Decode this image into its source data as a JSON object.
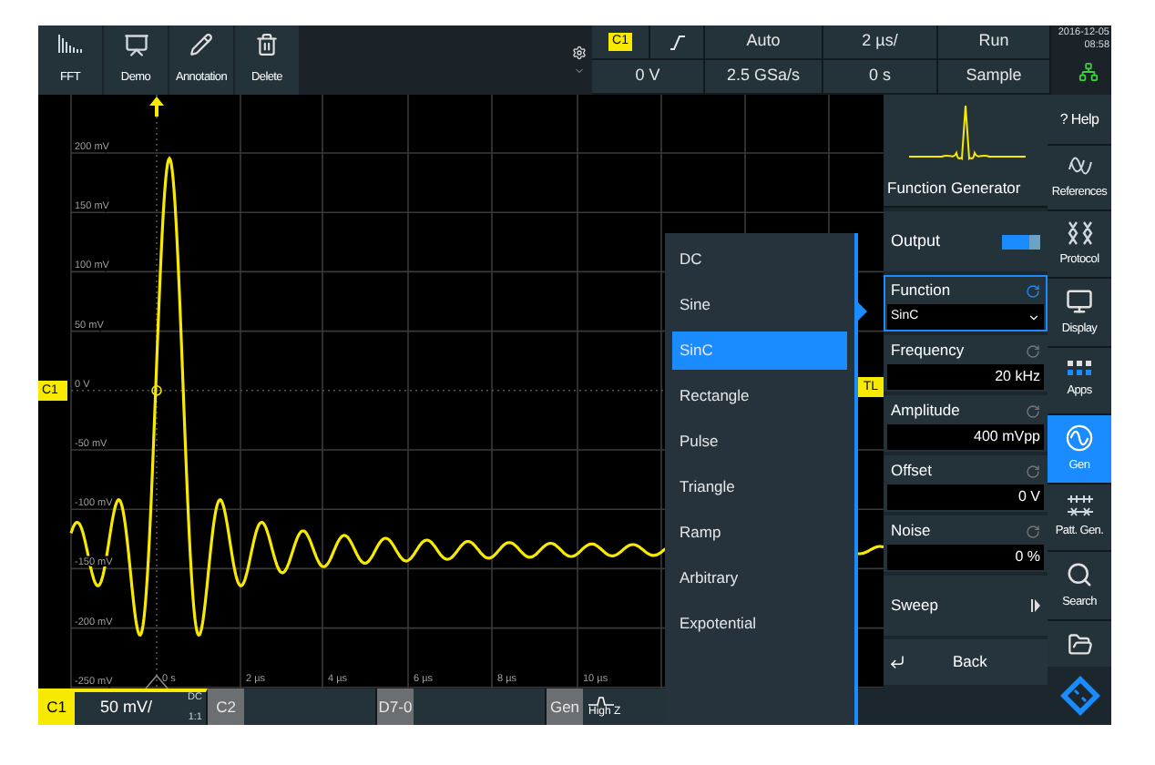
{
  "toolbar": [
    {
      "label": "FFT"
    },
    {
      "label": "Demo"
    },
    {
      "label": "Annotation"
    },
    {
      "label": "Delete"
    }
  ],
  "acquisition": {
    "channel": "C1",
    "trigger_level": "0 V",
    "trigger_mode": "Auto",
    "sample_rate": "2.5 GSa/s",
    "timebase": "2 µs/",
    "position": "0 s",
    "run_state": "Run",
    "acquisition_mode": "Sample",
    "date": "2016-12-05",
    "time": "08:58"
  },
  "waveform": {
    "channel_marker": "C1",
    "trigger_marker": "TL",
    "y_labels": [
      "200 mV",
      "150 mV",
      "100 mV",
      "50 mV",
      "0 V",
      "-50 mV",
      "-100 mV",
      "-150 mV",
      "-200 mV",
      "-250 mV"
    ],
    "x_labels": [
      "0 s",
      "2 µs",
      "4 µs",
      "6 µs",
      "8 µs",
      "10 µs"
    ]
  },
  "function_menu": {
    "items": [
      {
        "label": "DC",
        "selected": false
      },
      {
        "label": "Sine",
        "selected": false
      },
      {
        "label": "SinC",
        "selected": true
      },
      {
        "label": "Rectangle",
        "selected": false
      },
      {
        "label": "Pulse",
        "selected": false
      },
      {
        "label": "Triangle",
        "selected": false
      },
      {
        "label": "Ramp",
        "selected": false
      },
      {
        "label": "Arbitrary",
        "selected": false
      },
      {
        "label": "Expotential",
        "selected": false
      }
    ]
  },
  "generator_panel": {
    "title": "Function Generator",
    "output": {
      "label": "Output",
      "on": true
    },
    "fields": [
      {
        "label": "Function",
        "value": "SinC",
        "kind": "dropdown",
        "selected": true
      },
      {
        "label": "Frequency",
        "value": "20 kHz",
        "kind": "number",
        "selected": false
      },
      {
        "label": "Amplitude",
        "value": "400 mVpp",
        "kind": "number",
        "selected": false
      },
      {
        "label": "Offset",
        "value": "0 V",
        "kind": "number",
        "selected": false
      },
      {
        "label": "Noise",
        "value": "0 %",
        "kind": "number",
        "selected": false
      }
    ],
    "sweep": "Sweep",
    "back": "Back"
  },
  "sidebar": [
    {
      "label": "? Help",
      "selected": false
    },
    {
      "label": "References",
      "selected": false
    },
    {
      "label": "Protocol",
      "selected": false
    },
    {
      "label": "Display",
      "selected": false
    },
    {
      "label": "Apps",
      "selected": false
    },
    {
      "label": "Gen",
      "selected": true
    },
    {
      "label": "Patt. Gen.",
      "selected": false
    },
    {
      "label": "Search",
      "selected": false
    }
  ],
  "status_bar": {
    "channels": [
      {
        "label": "C1",
        "active": true,
        "scale": "50 mV/",
        "coupling": "DC",
        "probe": "1:1"
      },
      {
        "label": "C2",
        "active": false
      },
      {
        "label": "D7-0",
        "active": false
      },
      {
        "label": "Gen",
        "active": false,
        "load": "High Z"
      }
    ]
  }
}
